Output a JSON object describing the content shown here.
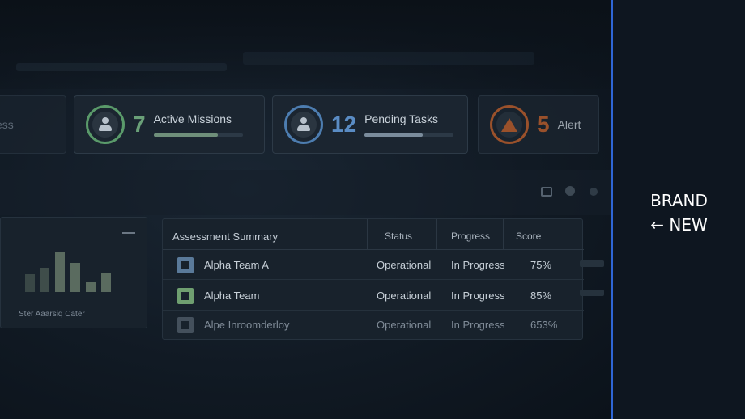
{
  "stats": {
    "partial_label": "ess",
    "missions": {
      "count": "7",
      "label": "Active Missions",
      "progress": 0.72,
      "icon": "person-icon",
      "color": "#6aa078"
    },
    "tasks": {
      "count": "12",
      "label": "Pending Tasks",
      "progress": 0.65,
      "icon": "person-icon",
      "color": "#5a8cc4"
    },
    "alerts": {
      "count": "5",
      "label": "Alert",
      "icon": "warning-icon",
      "color": "#c8642e"
    }
  },
  "chart": {
    "caption": "Ster Aaarsiq Cater"
  },
  "table": {
    "title": "Assessment Summary",
    "columns": {
      "status": "Status",
      "progress": "Progress",
      "score": "Score"
    },
    "rows": [
      {
        "name": "Alpha Team A",
        "status": "Operational",
        "progress": "In Progress",
        "score": "75%"
      },
      {
        "name": "Alpha Team",
        "status": "Operational",
        "progress": "In Progress",
        "score": "85%"
      },
      {
        "name": "Alpe Inroomderloy",
        "status": "Operational",
        "progress": "In Progress",
        "score": "653%"
      }
    ]
  },
  "brand": {
    "line1": "BRAND",
    "line2": "← NEW",
    "accent": "#2f66d6"
  }
}
